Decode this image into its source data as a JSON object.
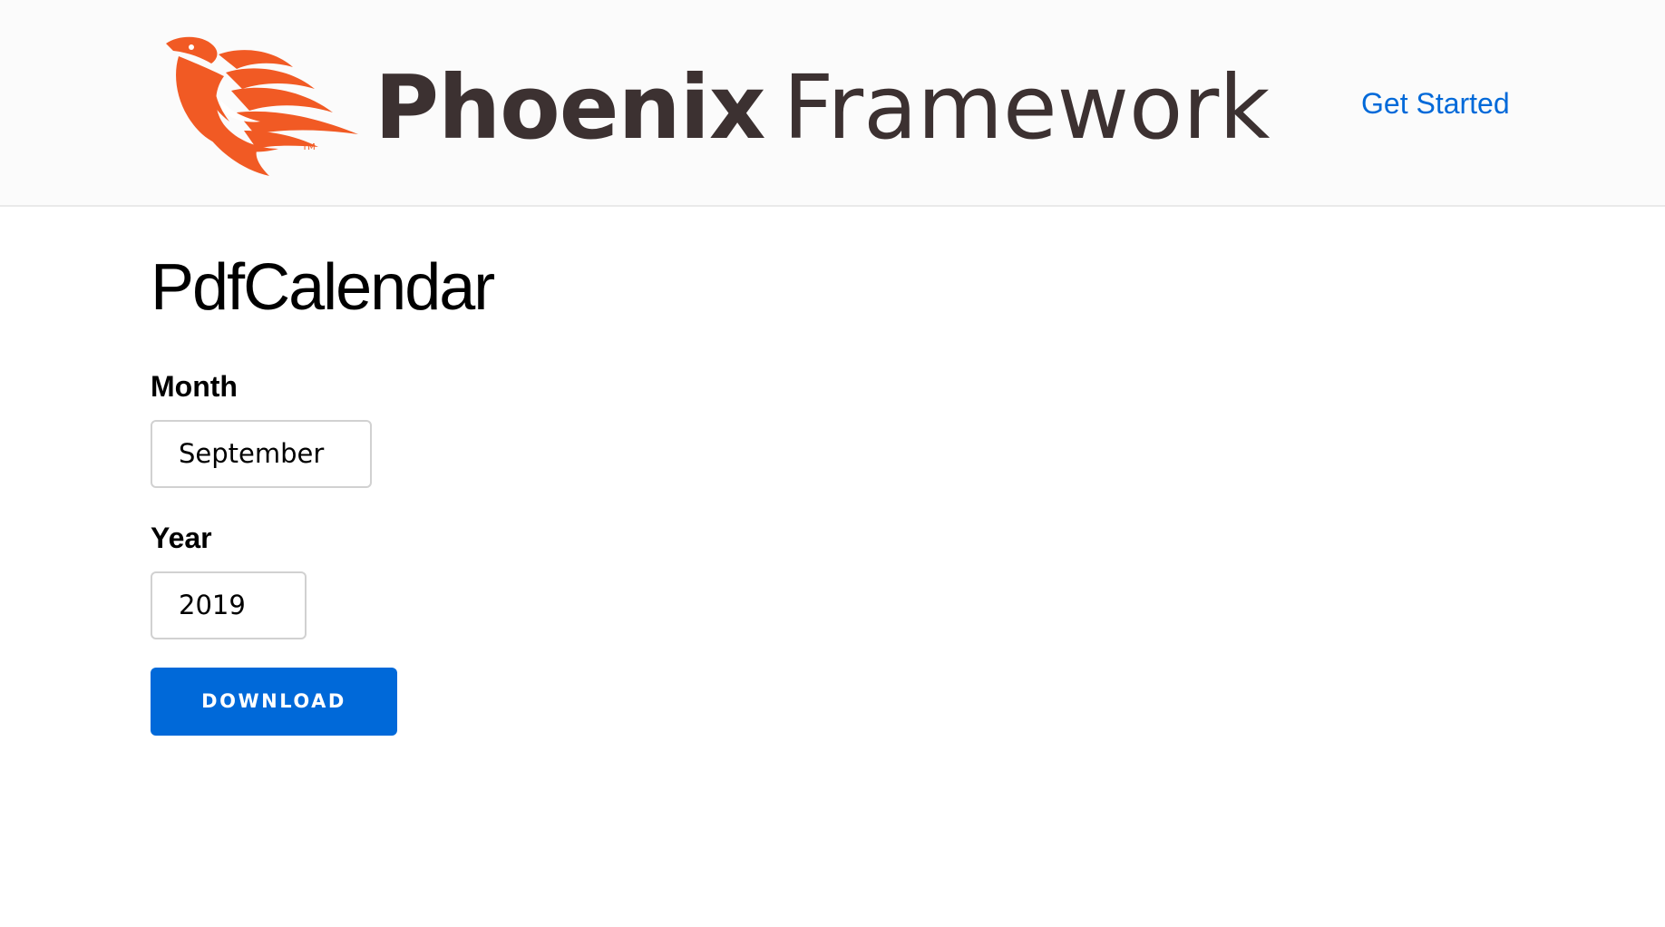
{
  "header": {
    "logo": {
      "word_bold": "Phoenix",
      "word_light": "Framework",
      "mark_icon": "phoenix-bird-icon",
      "mark_color": "#f15a24",
      "text_color": "#3c3131"
    },
    "nav": {
      "get_started": "Get Started"
    }
  },
  "main": {
    "title": "PdfCalendar",
    "month": {
      "label": "Month",
      "value": "September"
    },
    "year": {
      "label": "Year",
      "value": "2019"
    },
    "download_label": "DOWNLOAD"
  },
  "colors": {
    "accent": "#0069d9",
    "header_background": "#fbfbfb",
    "border": "#d1d1d1"
  }
}
